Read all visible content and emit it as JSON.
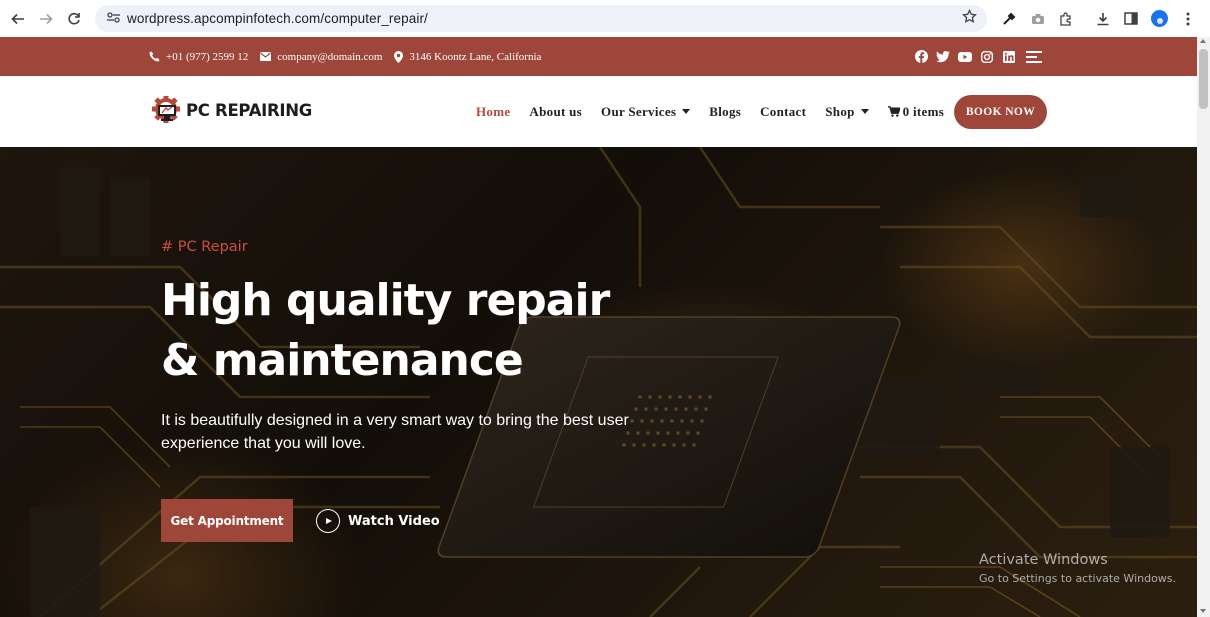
{
  "browser": {
    "url": "wordpress.apcompinfotech.com/computer_repair/",
    "icons": [
      "back-arrow-icon",
      "forward-arrow-icon",
      "reload-icon",
      "site-settings-icon",
      "bookmark-star-icon",
      "eyedropper-icon",
      "camera-icon",
      "extensions-puzzle-icon",
      "download-icon",
      "side-panel-icon",
      "profile-avatar-icon",
      "more-vertical-icon"
    ]
  },
  "topbar": {
    "phone": "+01 (977) 2599 12",
    "email": "company@domain.com",
    "address": "3146 Koontz Lane, California",
    "socials": [
      "facebook-icon",
      "twitter-icon",
      "youtube-icon",
      "instagram-icon",
      "linkedin-icon"
    ],
    "bg_color": "#9e4639"
  },
  "header": {
    "logo_text": "PC REPAIRING",
    "nav": [
      {
        "label": "Home",
        "active": true
      },
      {
        "label": "About us"
      },
      {
        "label": "Our Services",
        "dropdown": true
      },
      {
        "label": "Blogs"
      },
      {
        "label": "Contact"
      },
      {
        "label": "Shop",
        "dropdown": true
      }
    ],
    "cart_label": "0 items",
    "book_button": "BOOK NOW",
    "accent_color": "#b34a3b"
  },
  "hero": {
    "tag": "# PC Repair",
    "headline_line1": "High quality repair",
    "headline_line2": "& maintenance",
    "description": "It is beautifully designed in a very smart way to bring the best user experience that you will love.",
    "primary_button": "Get Appointment",
    "video_link": "Watch Video"
  },
  "watermark": {
    "title": "Activate Windows",
    "subtitle": "Go to Settings to activate Windows."
  }
}
